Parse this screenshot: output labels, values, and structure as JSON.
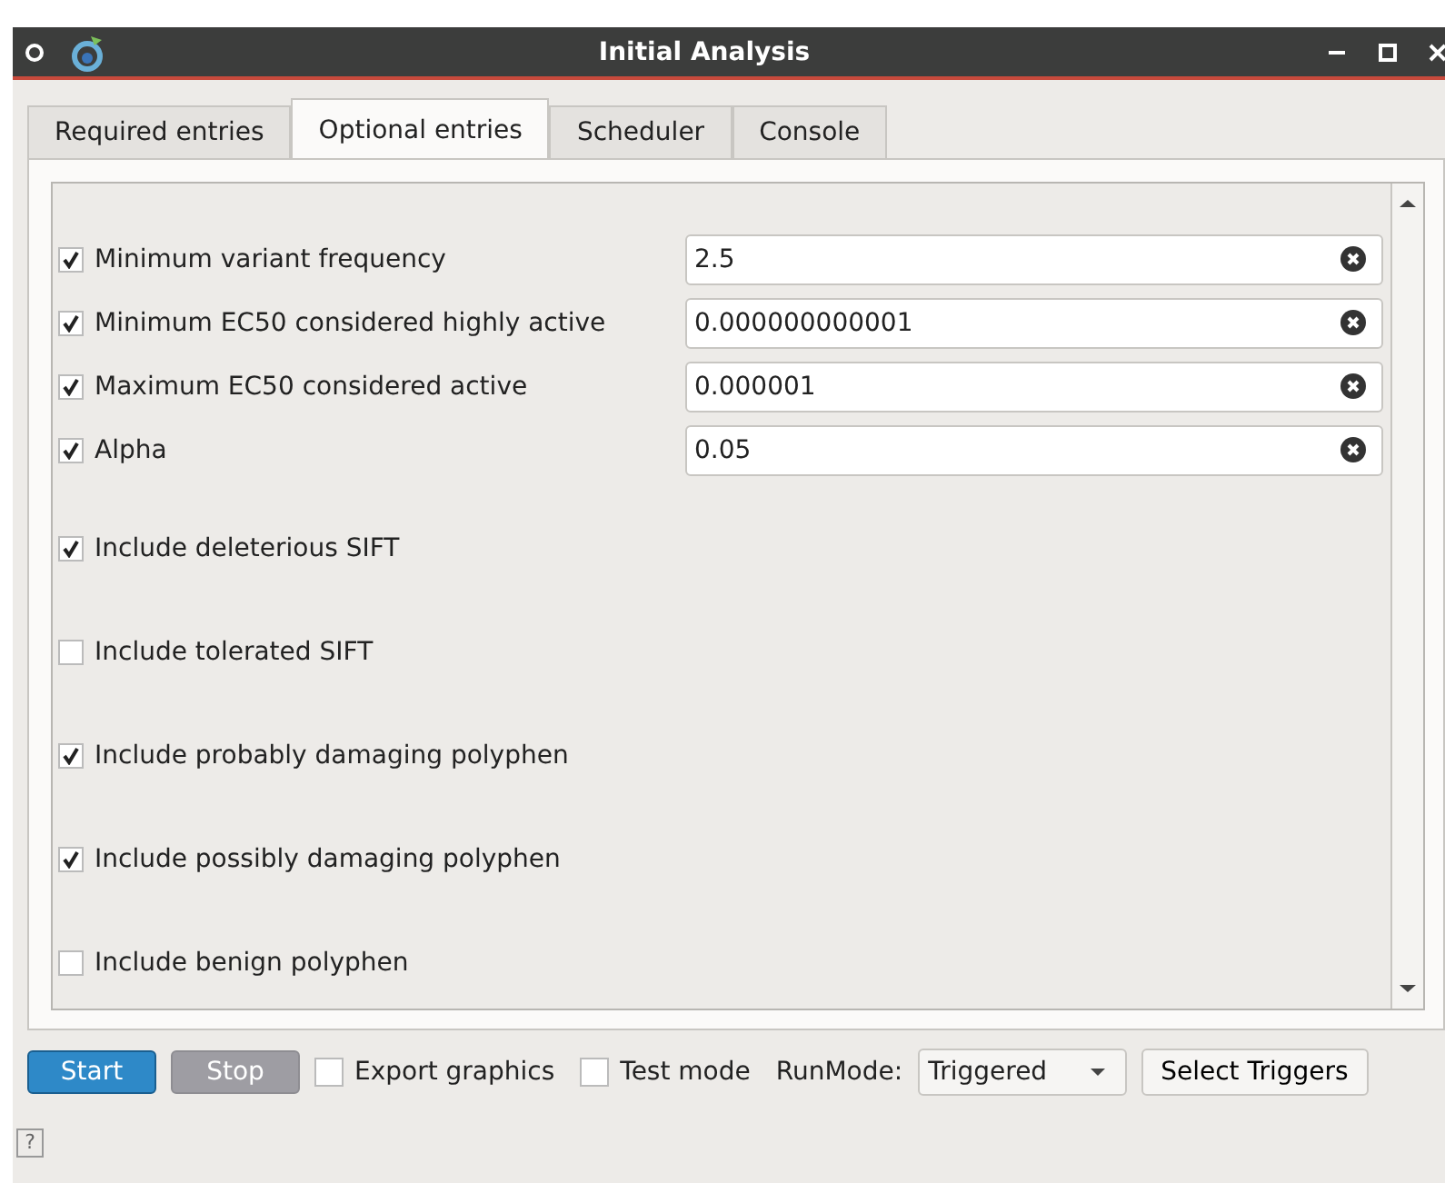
{
  "window": {
    "title": "Initial Analysis"
  },
  "tabs": [
    {
      "label": "Required entries",
      "selected": false
    },
    {
      "label": "Optional entries",
      "selected": true
    },
    {
      "label": "Scheduler",
      "selected": false
    },
    {
      "label": "Console",
      "selected": false
    }
  ],
  "options": [
    {
      "kind": "field",
      "label": "Minimum variant frequency",
      "checked": true,
      "value": "2.5"
    },
    {
      "kind": "field",
      "label": "Minimum EC50 considered highly active",
      "checked": true,
      "value": "0.000000000001"
    },
    {
      "kind": "field",
      "label": "Maximum EC50 considered active",
      "checked": true,
      "value": "0.000001"
    },
    {
      "kind": "field",
      "label": "Alpha",
      "checked": true,
      "value": "0.05"
    },
    {
      "kind": "check",
      "label": "Include deleterious SIFT",
      "checked": true
    },
    {
      "kind": "check",
      "label": "Include tolerated SIFT",
      "checked": false
    },
    {
      "kind": "check",
      "label": "Include probably damaging polyphen",
      "checked": true
    },
    {
      "kind": "check",
      "label": "Include possibly damaging polyphen",
      "checked": true
    },
    {
      "kind": "check",
      "label": "Include benign polyphen",
      "checked": false
    }
  ],
  "toolbar": {
    "start": "Start",
    "stop": "Stop",
    "stop_disabled": true,
    "export_graphics": {
      "label": "Export graphics",
      "checked": false
    },
    "test_mode": {
      "label": "Test mode",
      "checked": false
    },
    "run_mode_label": "RunMode:",
    "run_mode": "Triggered",
    "select_triggers": "Select Triggers"
  },
  "help": "?"
}
